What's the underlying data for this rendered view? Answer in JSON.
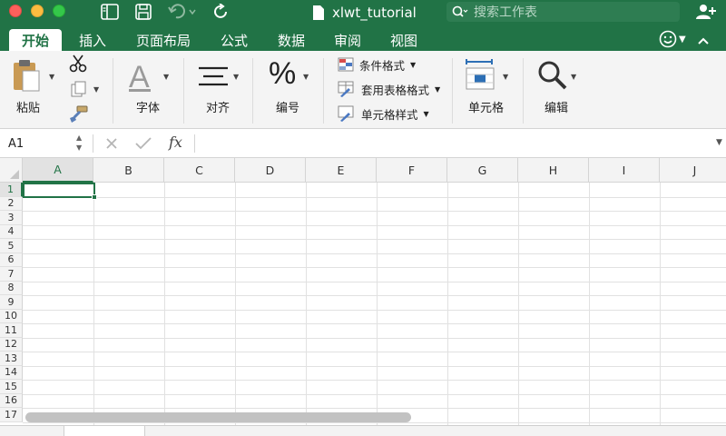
{
  "window": {
    "title": "xlwt_tutorial",
    "search_placeholder": "搜索工作表"
  },
  "tabs": [
    {
      "label": "开始",
      "active": true
    },
    {
      "label": "插入"
    },
    {
      "label": "页面布局"
    },
    {
      "label": "公式"
    },
    {
      "label": "数据"
    },
    {
      "label": "审阅"
    },
    {
      "label": "视图"
    }
  ],
  "ribbon": {
    "paste_label": "粘贴",
    "font_label": "字体",
    "align_label": "对齐",
    "number_label": "编号",
    "styles": {
      "conditional": "条件格式",
      "table_format": "套用表格格式",
      "cell_style": "单元格样式"
    },
    "cells_label": "单元格",
    "edit_label": "编辑"
  },
  "formula_bar": {
    "name_box": "A1",
    "fx": "fx",
    "formula": ""
  },
  "sheet": {
    "columns": [
      "A",
      "B",
      "C",
      "D",
      "E",
      "F",
      "G",
      "H",
      "I",
      "J"
    ],
    "rows": [
      "1",
      "2",
      "3",
      "4",
      "5",
      "6",
      "7",
      "8",
      "9",
      "10",
      "11",
      "12",
      "13",
      "14",
      "15",
      "16",
      "17"
    ],
    "selected_cell": "A1"
  },
  "colors": {
    "accent": "#217346"
  }
}
